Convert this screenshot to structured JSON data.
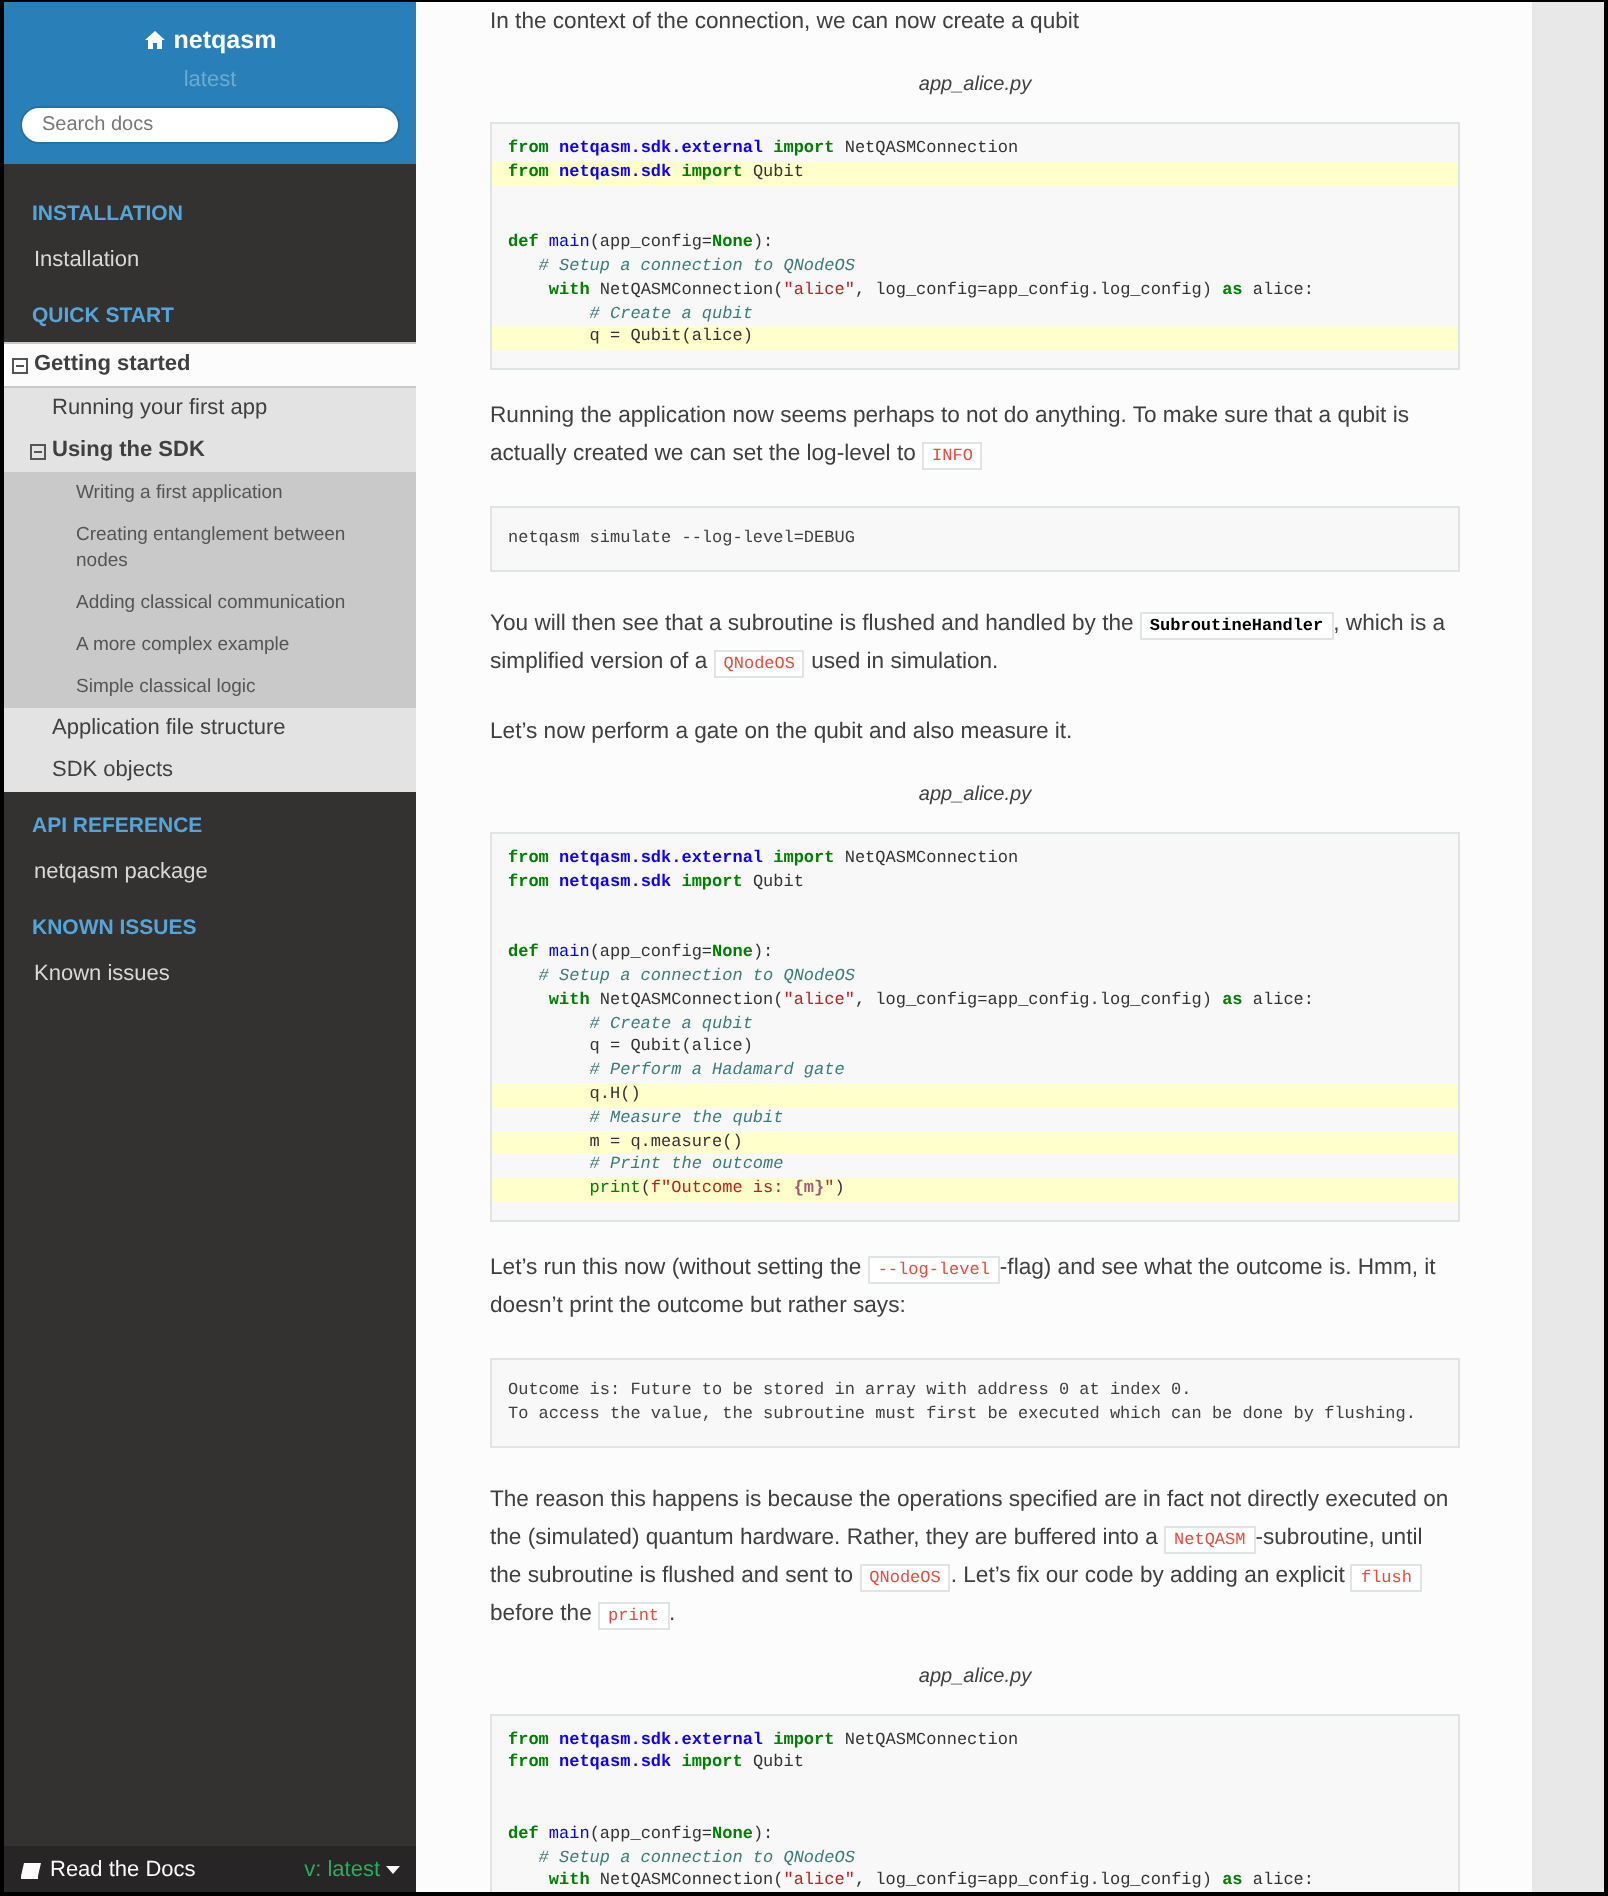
{
  "sidebar": {
    "project": "netqasm",
    "version": "latest",
    "search": {
      "placeholder": "Search docs"
    },
    "sections": [
      {
        "caption": "INSTALLATION",
        "items": [
          {
            "label": "Installation",
            "selected": false
          }
        ]
      },
      {
        "caption": "QUICK START",
        "items": [
          {
            "label": "Getting started",
            "selected": true,
            "expanded": true,
            "children": [
              {
                "label": "Running your first app",
                "selected": false
              },
              {
                "label": "Using the SDK",
                "selected": false,
                "expanded": true,
                "children": [
                  {
                    "label": "Writing a first application",
                    "selected": false
                  },
                  {
                    "label": "Creating entanglement between nodes",
                    "selected": false
                  },
                  {
                    "label": "Adding classical communication",
                    "selected": false
                  },
                  {
                    "label": "A more complex example",
                    "selected": false
                  },
                  {
                    "label": "Simple classical logic",
                    "selected": false
                  }
                ]
              },
              {
                "label": "Application file structure",
                "selected": false
              },
              {
                "label": "SDK objects",
                "selected": false
              }
            ]
          }
        ]
      },
      {
        "caption": "API REFERENCE",
        "items": [
          {
            "label": "netqasm package",
            "selected": false
          }
        ]
      },
      {
        "caption": "KNOWN ISSUES",
        "items": [
          {
            "label": "Known issues",
            "selected": false
          }
        ]
      }
    ],
    "footer": {
      "brand": "Read the Docs",
      "version": "v: latest"
    }
  },
  "content": {
    "blocks": [
      {
        "kind": "paragraph",
        "segments": [
          {
            "kind": "text",
            "text": "In the context of the connection, we can now create a qubit"
          }
        ]
      },
      {
        "kind": "code",
        "caption": "app_alice.py",
        "lines": [
          {
            "highlighted": false,
            "tokens": [
              {
                "kind": "keyword",
                "text": "from"
              },
              {
                "kind": "namespace",
                "text": " netqasm.sdk.external"
              },
              {
                "kind": "keyword",
                "text": " import"
              },
              {
                "kind": "plain",
                "text": " NetQASMConnection"
              }
            ]
          },
          {
            "highlighted": true,
            "tokens": [
              {
                "kind": "keyword",
                "text": "from"
              },
              {
                "kind": "namespace",
                "text": " netqasm.sdk"
              },
              {
                "kind": "keyword",
                "text": " import"
              },
              {
                "kind": "plain",
                "text": " Qubit"
              }
            ]
          },
          {
            "highlighted": false
          },
          {
            "highlighted": false
          },
          {
            "highlighted": false,
            "tokens": [
              {
                "kind": "keyword",
                "text": "def"
              },
              {
                "kind": "function",
                "text": " main"
              },
              {
                "kind": "plain",
                "text": "(app_config="
              },
              {
                "kind": "keyword",
                "text": "None"
              },
              {
                "kind": "plain",
                "text": "):"
              }
            ]
          },
          {
            "highlighted": false,
            "tokens": [
              {
                "kind": "comment",
                "text": "   # Setup a connection to QNodeOS"
              }
            ]
          },
          {
            "highlighted": false,
            "tokens": [
              {
                "kind": "keyword",
                "text": "    with"
              },
              {
                "kind": "plain",
                "text": " NetQASMConnection("
              },
              {
                "kind": "string",
                "text": "\"alice\""
              },
              {
                "kind": "plain",
                "text": ", log_config=app_config.log_config)"
              },
              {
                "kind": "keyword",
                "text": " as"
              },
              {
                "kind": "plain",
                "text": " alice:"
              }
            ]
          },
          {
            "highlighted": false,
            "tokens": [
              {
                "kind": "comment",
                "text": "        # Create a qubit"
              }
            ]
          },
          {
            "highlighted": true,
            "tokens": [
              {
                "kind": "plain",
                "text": "        q = Qubit(alice)"
              }
            ]
          }
        ]
      },
      {
        "kind": "paragraph",
        "segments": [
          {
            "kind": "text",
            "text": "Running the application now seems perhaps to not do anything. To make sure that a qubit is actually created we can set the log-level to "
          },
          {
            "kind": "code",
            "text": "INFO"
          }
        ]
      },
      {
        "kind": "console",
        "lines": [
          "netqasm simulate --log-level=DEBUG"
        ]
      },
      {
        "kind": "paragraph",
        "segments": [
          {
            "kind": "text",
            "text": "You will then see that a subroutine is flushed and handled by the "
          },
          {
            "kind": "ref",
            "text": "SubroutineHandler"
          },
          {
            "kind": "text",
            "text": ", which is a simplified version of a "
          },
          {
            "kind": "code",
            "text": "QNodeOS"
          },
          {
            "kind": "text",
            "text": " used in simulation."
          }
        ]
      },
      {
        "kind": "paragraph",
        "segments": [
          {
            "kind": "text",
            "text": "Let’s now perform a gate on the qubit and also measure it."
          }
        ]
      },
      {
        "kind": "code",
        "caption": "app_alice.py",
        "lines": [
          {
            "highlighted": false,
            "tokens": [
              {
                "kind": "keyword",
                "text": "from"
              },
              {
                "kind": "namespace",
                "text": " netqasm.sdk.external"
              },
              {
                "kind": "keyword",
                "text": " import"
              },
              {
                "kind": "plain",
                "text": " NetQASMConnection"
              }
            ]
          },
          {
            "highlighted": false,
            "tokens": [
              {
                "kind": "keyword",
                "text": "from"
              },
              {
                "kind": "namespace",
                "text": " netqasm.sdk"
              },
              {
                "kind": "keyword",
                "text": " import"
              },
              {
                "kind": "plain",
                "text": " Qubit"
              }
            ]
          },
          {
            "highlighted": false
          },
          {
            "highlighted": false
          },
          {
            "highlighted": false,
            "tokens": [
              {
                "kind": "keyword",
                "text": "def"
              },
              {
                "kind": "function",
                "text": " main"
              },
              {
                "kind": "plain",
                "text": "(app_config="
              },
              {
                "kind": "keyword",
                "text": "None"
              },
              {
                "kind": "plain",
                "text": "):"
              }
            ]
          },
          {
            "highlighted": false,
            "tokens": [
              {
                "kind": "comment",
                "text": "   # Setup a connection to QNodeOS"
              }
            ]
          },
          {
            "highlighted": false,
            "tokens": [
              {
                "kind": "keyword",
                "text": "    with"
              },
              {
                "kind": "plain",
                "text": " NetQASMConnection("
              },
              {
                "kind": "string",
                "text": "\"alice\""
              },
              {
                "kind": "plain",
                "text": ", log_config=app_config.log_config)"
              },
              {
                "kind": "keyword",
                "text": " as"
              },
              {
                "kind": "plain",
                "text": " alice:"
              }
            ]
          },
          {
            "highlighted": false,
            "tokens": [
              {
                "kind": "comment",
                "text": "        # Create a qubit"
              }
            ]
          },
          {
            "highlighted": false,
            "tokens": [
              {
                "kind": "plain",
                "text": "        q = Qubit(alice)"
              }
            ]
          },
          {
            "highlighted": false,
            "tokens": [
              {
                "kind": "comment",
                "text": "        # Perform a Hadamard gate"
              }
            ]
          },
          {
            "highlighted": true,
            "tokens": [
              {
                "kind": "plain",
                "text": "        q.H()"
              }
            ]
          },
          {
            "highlighted": false,
            "tokens": [
              {
                "kind": "comment",
                "text": "        # Measure the qubit"
              }
            ]
          },
          {
            "highlighted": true,
            "tokens": [
              {
                "kind": "plain",
                "text": "        m = q.measure()"
              }
            ]
          },
          {
            "highlighted": false,
            "tokens": [
              {
                "kind": "comment",
                "text": "        # Print the outcome"
              }
            ]
          },
          {
            "highlighted": true,
            "tokens": [
              {
                "kind": "builtin",
                "text": "        print"
              },
              {
                "kind": "plain",
                "text": "("
              },
              {
                "kind": "string",
                "text": "f\"Outcome is:"
              },
              {
                "kind": "interpolation",
                "text": " {m}"
              },
              {
                "kind": "string",
                "text": "\""
              },
              {
                "kind": "plain",
                "text": ")"
              }
            ]
          }
        ]
      },
      {
        "kind": "paragraph",
        "segments": [
          {
            "kind": "text",
            "text": "Let’s run this now (without setting the "
          },
          {
            "kind": "code",
            "text": "--log-level"
          },
          {
            "kind": "text",
            "text": "-flag) and see what the outcome is. Hmm, it doesn’t print the outcome but rather says:"
          }
        ]
      },
      {
        "kind": "console",
        "lines": [
          "Outcome is: Future to be stored in array with address 0 at index 0.",
          "To access the value, the subroutine must first be executed which can be done by flushing."
        ]
      },
      {
        "kind": "paragraph",
        "segments": [
          {
            "kind": "text",
            "text": "The reason this happens is because the operations specified are in fact not directly executed on the (simulated) quantum hardware. Rather, they are buffered into a "
          },
          {
            "kind": "code",
            "text": "NetQASM"
          },
          {
            "kind": "text",
            "text": "-subroutine, until the subroutine is flushed and sent to "
          },
          {
            "kind": "code",
            "text": "QNodeOS"
          },
          {
            "kind": "text",
            "text": ". Let’s fix our code by adding an explicit "
          },
          {
            "kind": "code",
            "text": "flush"
          },
          {
            "kind": "text",
            "text": " before the "
          },
          {
            "kind": "code",
            "text": "print"
          },
          {
            "kind": "text",
            "text": "."
          }
        ]
      },
      {
        "kind": "code",
        "caption": "app_alice.py",
        "lines": [
          {
            "highlighted": false,
            "tokens": [
              {
                "kind": "keyword",
                "text": "from"
              },
              {
                "kind": "namespace",
                "text": " netqasm.sdk.external"
              },
              {
                "kind": "keyword",
                "text": " import"
              },
              {
                "kind": "plain",
                "text": " NetQASMConnection"
              }
            ]
          },
          {
            "highlighted": false,
            "tokens": [
              {
                "kind": "keyword",
                "text": "from"
              },
              {
                "kind": "namespace",
                "text": " netqasm.sdk"
              },
              {
                "kind": "keyword",
                "text": " import"
              },
              {
                "kind": "plain",
                "text": " Qubit"
              }
            ]
          },
          {
            "highlighted": false
          },
          {
            "highlighted": false
          },
          {
            "highlighted": false,
            "tokens": [
              {
                "kind": "keyword",
                "text": "def"
              },
              {
                "kind": "function",
                "text": " main"
              },
              {
                "kind": "plain",
                "text": "(app_config="
              },
              {
                "kind": "keyword",
                "text": "None"
              },
              {
                "kind": "plain",
                "text": "):"
              }
            ]
          },
          {
            "highlighted": false,
            "tokens": [
              {
                "kind": "comment",
                "text": "   # Setup a connection to QNodeOS"
              }
            ]
          },
          {
            "highlighted": false,
            "tokens": [
              {
                "kind": "keyword",
                "text": "    with"
              },
              {
                "kind": "plain",
                "text": " NetQASMConnection("
              },
              {
                "kind": "string",
                "text": "\"alice\""
              },
              {
                "kind": "plain",
                "text": ", log_config=app_config.log_config)"
              },
              {
                "kind": "keyword",
                "text": " as"
              },
              {
                "kind": "plain",
                "text": " alice:"
              }
            ]
          }
        ]
      }
    ]
  }
}
